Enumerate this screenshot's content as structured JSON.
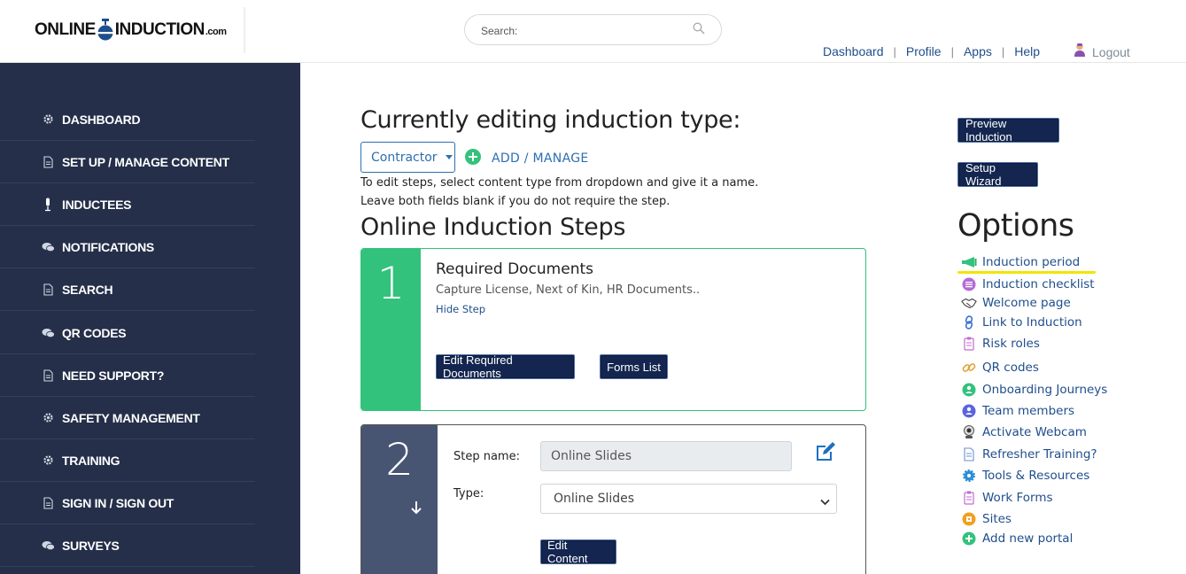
{
  "header": {
    "logo_left": "ONLINE",
    "logo_right": "INDUCTION",
    "logo_suffix": ".com",
    "search_placeholder": "Search:",
    "nav": [
      "Dashboard",
      "Profile",
      "Apps",
      "Help"
    ],
    "logout": "Logout"
  },
  "sidebar": {
    "items": [
      {
        "label": "DASHBOARD",
        "icon": "gear-icon"
      },
      {
        "label": "SET UP / MANAGE CONTENT",
        "icon": "document-icon"
      },
      {
        "label": "INDUCTEES",
        "icon": "microphone-icon"
      },
      {
        "label": "NOTIFICATIONS",
        "icon": "chat-icon"
      },
      {
        "label": "SEARCH",
        "icon": "document-icon"
      },
      {
        "label": "QR CODES",
        "icon": "chat-icon"
      },
      {
        "label": "NEED SUPPORT?",
        "icon": "document-icon"
      },
      {
        "label": "SAFETY MANAGEMENT",
        "icon": "gear-icon"
      },
      {
        "label": "TRAINING",
        "icon": "gear-icon"
      },
      {
        "label": "SIGN IN / SIGN OUT",
        "icon": "document-icon"
      },
      {
        "label": "SURVEYS",
        "icon": "chat-icon"
      }
    ]
  },
  "main": {
    "heading": "Currently editing induction type:",
    "dropdown_value": "Contractor",
    "add_manage": "ADD / MANAGE",
    "help_line1": "To edit steps, select content type from dropdown and give it a name.",
    "help_line2": "Leave both fields blank if you do not require the step.",
    "steps_heading": "Online Induction Steps",
    "step1": {
      "number": "1",
      "title": "Required Documents",
      "description": "Capture License, Next of Kin, HR Documents..",
      "hide_link": "Hide Step",
      "edit_button": "Edit Required Documents",
      "forms_button": "Forms List"
    },
    "step2": {
      "number": "2",
      "name_label": "Step name:",
      "name_value": "Online Slides",
      "type_label": "Type:",
      "type_value": "Online Slides",
      "edit_button": "Edit Content"
    }
  },
  "right": {
    "preview_button": "Preview Induction",
    "wizard_button": "Setup Wizard",
    "options_heading": "Options",
    "options": [
      {
        "label": "Induction period",
        "icon": "megaphone-icon",
        "color": "#33c27c"
      },
      {
        "label": "Induction checklist",
        "icon": "checklist-icon",
        "color": "#b46ad6"
      },
      {
        "label": "Welcome page",
        "icon": "handshake-icon",
        "color": "#333333"
      },
      {
        "label": "Link to Induction",
        "icon": "link-icon",
        "color": "#3d6fd1"
      },
      {
        "label": "Risk roles",
        "icon": "clipboard-icon",
        "color": "#c26ad0"
      },
      {
        "label": "QR codes",
        "icon": "chain-icon",
        "color": "#e0a33a"
      },
      {
        "label": "Onboarding Journeys",
        "icon": "journey-icon",
        "color": "#33c27c"
      },
      {
        "label": "Team members",
        "icon": "team-icon",
        "color": "#5b63e0"
      },
      {
        "label": "Activate Webcam",
        "icon": "webcam-icon",
        "color": "#555555"
      },
      {
        "label": "Refresher Training?",
        "icon": "refresh-doc-icon",
        "color": "#6a8fd6"
      },
      {
        "label": "Tools & Resources",
        "icon": "tools-icon",
        "color": "#2b8fd6"
      },
      {
        "label": "Work Forms",
        "icon": "form-icon",
        "color": "#c26ad0"
      },
      {
        "label": "Sites",
        "icon": "sites-icon",
        "color": "#f0a020"
      },
      {
        "label": "Add new portal",
        "icon": "plus-circle-icon",
        "color": "#33c27c"
      }
    ]
  }
}
